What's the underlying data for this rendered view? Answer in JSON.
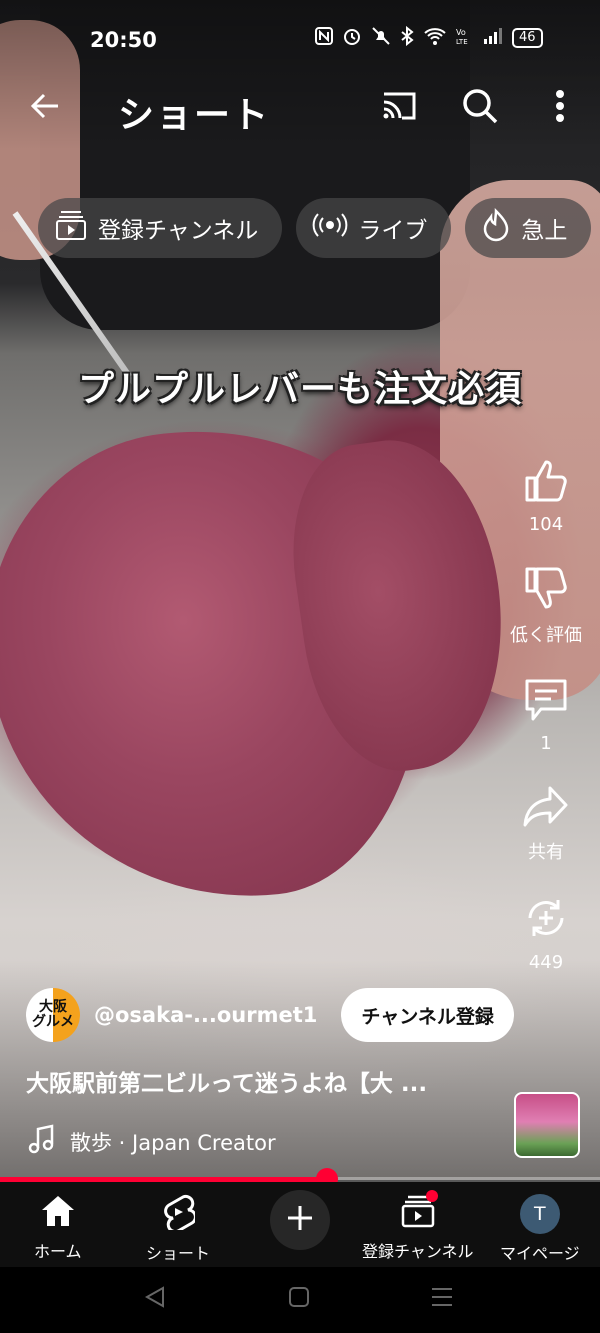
{
  "status_bar": {
    "time": "20:50",
    "battery": "46"
  },
  "header": {
    "title": "ショート"
  },
  "chips": [
    {
      "label": "登録チャンネル",
      "icon": "subscriptions-icon"
    },
    {
      "label": "ライブ",
      "icon": "live-icon"
    },
    {
      "label": "急上",
      "icon": "trending-icon"
    }
  ],
  "video": {
    "overlay_text": "プルプルレバーも注文必須",
    "progress": 0.545
  },
  "actions": {
    "like_count": "104",
    "dislike_label": "低く評価",
    "comment_count": "1",
    "share_label": "共有",
    "remix_count": "449"
  },
  "channel": {
    "handle": "@osaka-...ourmet1",
    "avatar_text": "大阪\nグルメ",
    "subscribe_label": "チャンネル登録"
  },
  "video_title": "大阪駅前第二ビルって迷うよね【大 ...",
  "music": {
    "label": "散歩 · Japan Creator"
  },
  "bottom_nav": {
    "home": "ホーム",
    "shorts": "ショート",
    "subscriptions": "登録チャンネル",
    "mypage": "マイページ",
    "avatar_initial": "T"
  },
  "colors": {
    "accent": "#ff0033",
    "nav_bg": "#0f0f0f"
  }
}
